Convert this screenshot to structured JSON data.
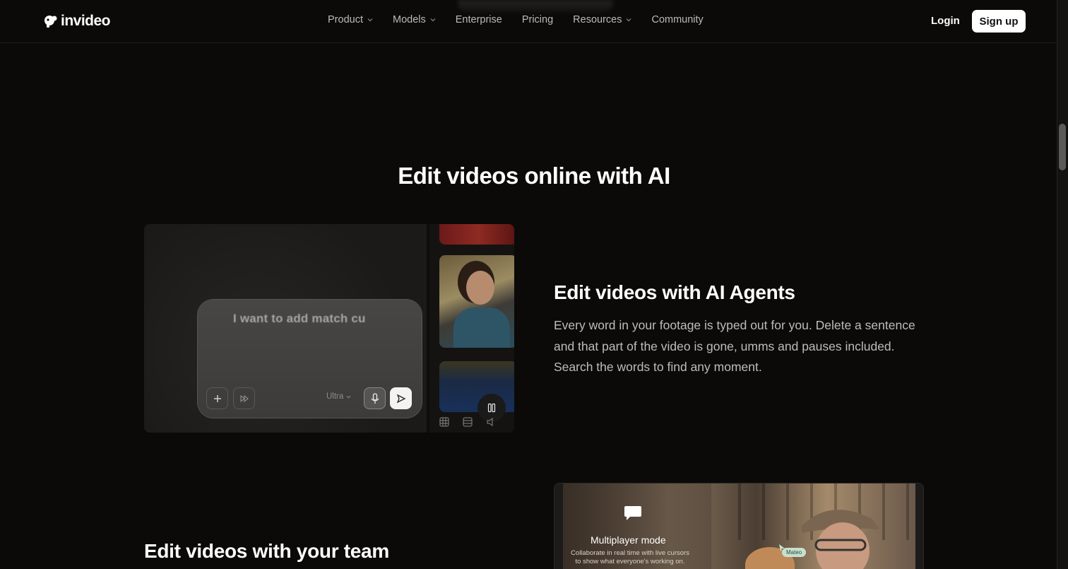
{
  "nav": {
    "brand": "invideo",
    "links": [
      {
        "label": "Product",
        "has_dropdown": true
      },
      {
        "label": "Models",
        "has_dropdown": true
      },
      {
        "label": "Enterprise",
        "has_dropdown": false
      },
      {
        "label": "Pricing",
        "has_dropdown": false
      },
      {
        "label": "Resources",
        "has_dropdown": true
      },
      {
        "label": "Community",
        "has_dropdown": false
      }
    ],
    "login": "Login",
    "signup": "Sign up"
  },
  "section": {
    "title": "Edit videos online with AI"
  },
  "feature1": {
    "title": "Edit videos with AI Agents",
    "description": "Every word in your footage is typed out for you. Delete a sentence and that part of the video is gone, umms and pauses included. Search the words to find any moment.",
    "prompt_text": "I want to add match cu",
    "model_select": "Ultra"
  },
  "feature2": {
    "title": "Edit videos with your team",
    "overlay_title": "Multiplayer mode",
    "overlay_desc": "Collaborate in real time with live cursors to show what everyone's working on.",
    "cursor_name": "Mateo"
  },
  "colors": {
    "background": "#0b0a09",
    "signup_bg": "#ffffff",
    "muted_text": "#bfbcb8"
  }
}
